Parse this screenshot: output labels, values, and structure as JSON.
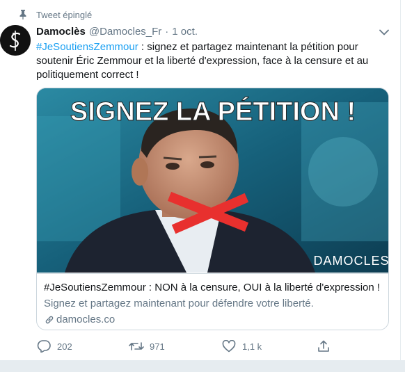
{
  "pinned": {
    "label": "Tweet épinglé",
    "icon": "pin-icon"
  },
  "author": {
    "name": "Damoclès",
    "handle": "@Damocles_Fr",
    "separator": "·",
    "date": "1 oct.",
    "avatar_icon": "damocles-logo-icon"
  },
  "tweet": {
    "hashtag": "#JeSoutiensZemmour",
    "text": " : signez et partagez maintenant la pétition pour soutenir Éric Zemmour et la liberté d'expression, face à la censure et au politiquement correct !"
  },
  "card": {
    "image_headline": "SIGNEZ LA PÉTITION !",
    "image_watermark": "DAMOCLES",
    "title": "#JeSoutiensZemmour : NON à la censure, OUI à la liberté d'expression !",
    "description": "Signez et partagez maintenant pour défendre votre liberté.",
    "domain": "damocles.co"
  },
  "actions": {
    "replies": "202",
    "retweets": "971",
    "likes": "1,1 k"
  },
  "colors": {
    "link": "#1da1f2",
    "muted": "#657786",
    "text": "#14171a",
    "border": "#ccd6dd",
    "cross": "#e8302e"
  }
}
